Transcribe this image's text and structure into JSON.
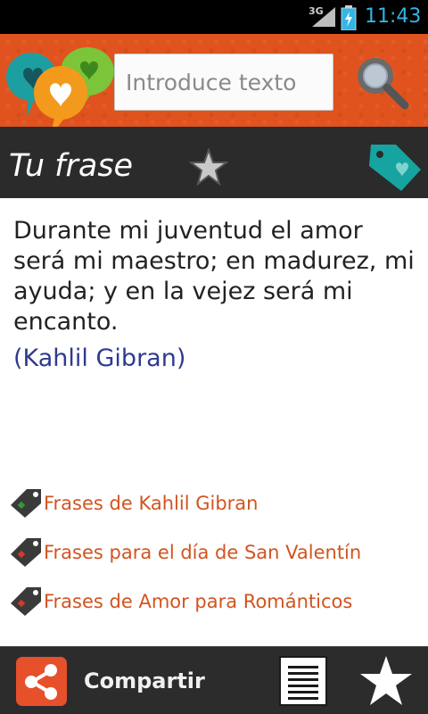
{
  "status_bar": {
    "network": "3G",
    "time": "11:43"
  },
  "header": {
    "search_placeholder": "Introduce texto"
  },
  "titlebar": {
    "title": "Tu frase"
  },
  "quote": {
    "text": "Durante mi juventud el amor será mi maestro; en madurez, mi ayuda; y en la vejez será mi encanto.",
    "author": "(Kahlil Gibran)"
  },
  "related_links": [
    {
      "label": "Frases de Kahlil Gibran"
    },
    {
      "label": "Frases para el día de San Valentín"
    },
    {
      "label": "Frases de Amor para Románticos"
    }
  ],
  "bottom_bar": {
    "share_label": "Compartir"
  },
  "colors": {
    "header_orange": "#e0531f",
    "title_bar": "#2b2b2b",
    "link_orange": "#d2541f",
    "author_blue": "#2f3a8f",
    "clock_blue": "#33b5e5",
    "tag_teal": "#17a3a0"
  }
}
